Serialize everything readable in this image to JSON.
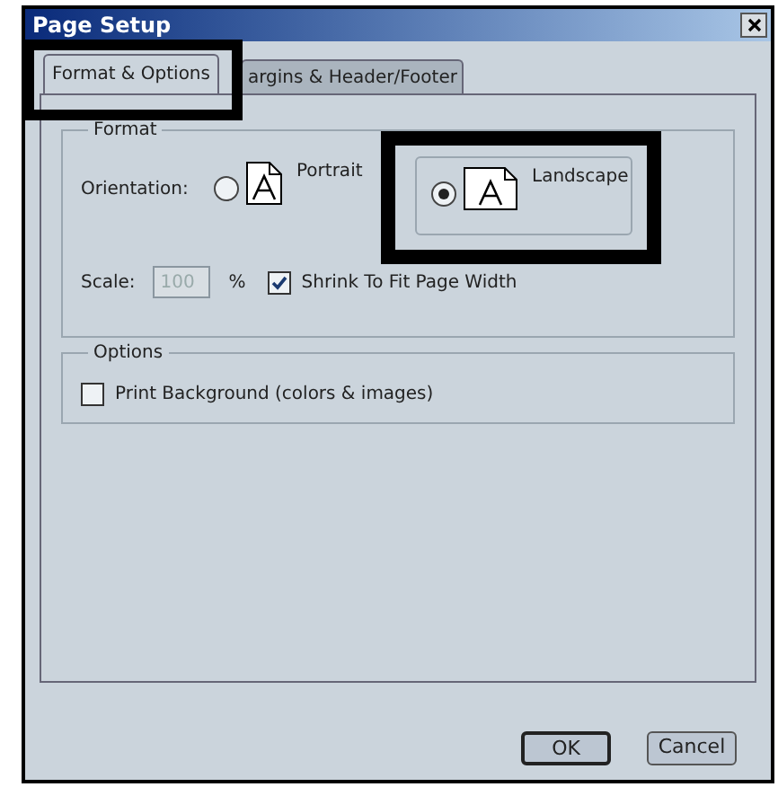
{
  "window": {
    "title": "Page Setup"
  },
  "tabs": [
    {
      "label": "Format & Options",
      "selected": true
    },
    {
      "label": "argins & Header/Footer",
      "selected": false
    }
  ],
  "format": {
    "legend": "Format",
    "orientation_label": "Orientation:",
    "orientations": [
      {
        "label": "Portrait",
        "selected": false
      },
      {
        "label": "Landscape",
        "selected": true
      }
    ],
    "scale_label": "Scale:",
    "scale_value": "100",
    "scale_disabled": true,
    "percent": "%",
    "shrink": {
      "label": "Shrink To Fit Page Width",
      "checked": true
    }
  },
  "options": {
    "legend": "Options",
    "print_background": {
      "label": "Print Background (colors & images)",
      "checked": false
    }
  },
  "buttons": [
    {
      "label": "OK",
      "default": true
    },
    {
      "label": "Cancel",
      "default": false
    }
  ]
}
